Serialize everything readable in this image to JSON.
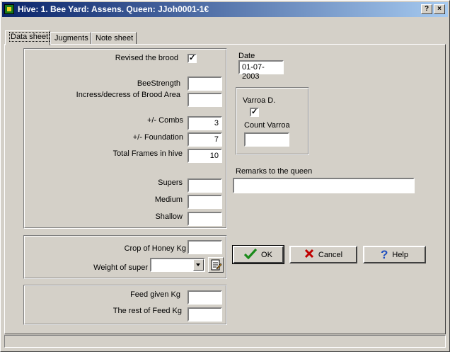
{
  "window": {
    "title": "Hive: 1. Bee Yard: Assens. Queen: JJoh0001-1€",
    "help_btn": "?",
    "close_btn": "×"
  },
  "tabs": [
    {
      "label": "Data sheet"
    },
    {
      "label": "Jugments"
    },
    {
      "label": "Note sheet"
    }
  ],
  "form": {
    "revised_brood_label": "Revised the brood",
    "revised_brood_checked": "✓",
    "bee_strength_label": "BeeStrength",
    "bee_strength_value": "",
    "brood_area_label": "Incress/decress of Brood Area",
    "brood_area_value": "",
    "combs_label": "+/- Combs",
    "combs_value": "3",
    "foundation_label": "+/- Foundation",
    "foundation_value": "7",
    "total_frames_label": "Total Frames in hive",
    "total_frames_value": "10",
    "supers_label": "Supers",
    "supers_value": "",
    "medium_label": "Medium",
    "medium_value": "",
    "shallow_label": "Shallow",
    "shallow_value": "",
    "crop_label": "Crop of Honey Kg",
    "crop_value": "",
    "weight_label": "Weight of super",
    "weight_value": "",
    "feed_label": "Feed given Kg",
    "feed_value": "",
    "rest_feed_label": "The rest of Feed Kg",
    "rest_feed_value": "",
    "date_label": "Date",
    "date_value": "01-07-2003",
    "varroa_label": "Varroa D.",
    "varroa_checked": "✓",
    "count_varroa_label": "Count Varroa",
    "count_varroa_value": "",
    "remarks_label": "Remarks to the queen",
    "remarks_value": ""
  },
  "buttons": {
    "ok": "OK",
    "cancel": "Cancel",
    "help": "Help"
  },
  "icons": {
    "ok": "check-icon",
    "cancel": "x-icon",
    "help": "question-icon",
    "super_edit": "notepad-icon",
    "dropdown": "dropdown-arrow-icon"
  },
  "colors": {
    "titlebar_start": "#0a246a",
    "titlebar_end": "#a6caf0",
    "face": "#d4d0c8",
    "ok_green": "#1a8a1a",
    "cancel_red": "#c00000",
    "help_blue": "#1f4fbf"
  }
}
